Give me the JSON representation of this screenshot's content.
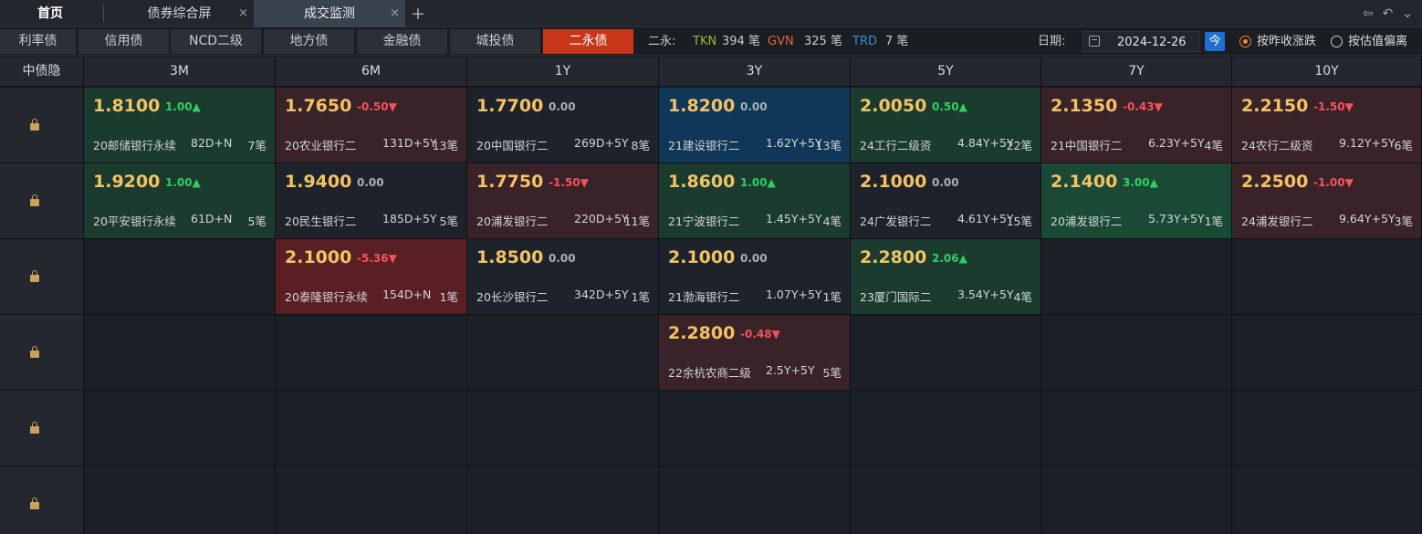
{
  "tabs": {
    "home": "首页",
    "bond_screen": "债券综合屏",
    "trade_monitor": "成交监测",
    "close": "×",
    "add": "+"
  },
  "window_controls": {
    "back_icon": "⇦",
    "undo_icon": "↶",
    "dropdown_icon": "⌄"
  },
  "categories": [
    "利率债",
    "信用债",
    "NCD二级",
    "地方债",
    "金融债",
    "城投债",
    "二永债"
  ],
  "active_category": "二永债",
  "summary": {
    "label": "二永:",
    "tkn_label": "TKN",
    "tkn_count": "394 笔",
    "gvn_label": "GVN",
    "gvn_count": "325 笔",
    "trd_label": "TRD",
    "trd_count": "7 笔"
  },
  "date": {
    "label": "日期:",
    "value": "2024-12-26",
    "today": "今"
  },
  "sort_options": {
    "by_change": "按昨收涨跌",
    "by_deviation": "按估值偏离",
    "selected": "按昨收涨跌"
  },
  "grid": {
    "corner": "中债隐",
    "columns": [
      "3M",
      "6M",
      "1Y",
      "3Y",
      "5Y",
      "7Y",
      "10Y"
    ],
    "rows": [
      [
        {
          "price": "1.8100",
          "chg": "1.00▲",
          "dir": "up",
          "name": "20邮储银行永续",
          "term": "82D+N",
          "count": "7笔"
        },
        {
          "price": "1.7650",
          "chg": "-0.50▼",
          "dir": "down",
          "name": "20农业银行二",
          "term": "131D+5Y",
          "count": "13笔"
        },
        {
          "price": "1.7700",
          "chg": "0.00",
          "dir": "flat",
          "name": "20中国银行二",
          "term": "269D+5Y",
          "count": "8笔"
        },
        {
          "price": "1.8200",
          "chg": "0.00",
          "dir": "blue",
          "name": "21建设银行二",
          "term": "1.62Y+5Y",
          "count": "13笔"
        },
        {
          "price": "2.0050",
          "chg": "0.50▲",
          "dir": "up",
          "name": "24工行二级资",
          "term": "4.84Y+5Y",
          "count": "22笔"
        },
        {
          "price": "2.1350",
          "chg": "-0.43▼",
          "dir": "down",
          "name": "21中国银行二",
          "term": "6.23Y+5Y",
          "count": "4笔"
        },
        {
          "price": "2.2150",
          "chg": "-1.50▼",
          "dir": "down",
          "name": "24农行二级资",
          "term": "9.12Y+5Y",
          "count": "6笔"
        }
      ],
      [
        {
          "price": "1.9200",
          "chg": "1.00▲",
          "dir": "up",
          "name": "20平安银行永续",
          "term": "61D+N",
          "count": "5笔"
        },
        {
          "price": "1.9400",
          "chg": "0.00",
          "dir": "flat",
          "name": "20民生银行二",
          "term": "185D+5Y",
          "count": "5笔"
        },
        {
          "price": "1.7750",
          "chg": "-1.50▼",
          "dir": "down",
          "name": "20浦发银行二",
          "term": "220D+5Y",
          "count": "11笔"
        },
        {
          "price": "1.8600",
          "chg": "1.00▲",
          "dir": "up",
          "name": "21宁波银行二",
          "term": "1.45Y+5Y",
          "count": "4笔"
        },
        {
          "price": "2.1000",
          "chg": "0.00",
          "dir": "flat",
          "name": "24广发银行二",
          "term": "4.61Y+5Y",
          "count": "15笔"
        },
        {
          "price": "2.1400",
          "chg": "3.00▲",
          "dir": "up2",
          "name": "20浦发银行二",
          "term": "5.73Y+5Y",
          "count": "1笔"
        },
        {
          "price": "2.2500",
          "chg": "-1.00▼",
          "dir": "down",
          "name": "24浦发银行二",
          "term": "9.64Y+5Y",
          "count": "3笔"
        }
      ],
      [
        null,
        {
          "price": "2.1000",
          "chg": "-5.36▼",
          "dir": "down2",
          "name": "20泰隆银行永续",
          "term": "154D+N",
          "count": "1笔"
        },
        {
          "price": "1.8500",
          "chg": "0.00",
          "dir": "flat",
          "name": "20长沙银行二",
          "term": "342D+5Y",
          "count": "1笔"
        },
        {
          "price": "2.1000",
          "chg": "0.00",
          "dir": "flat",
          "name": "21渤海银行二",
          "term": "1.07Y+5Y",
          "count": "1笔"
        },
        {
          "price": "2.2800",
          "chg": "2.06▲",
          "dir": "up",
          "name": "23厦门国际二",
          "term": "3.54Y+5Y",
          "count": "4笔"
        },
        null,
        null
      ],
      [
        null,
        null,
        null,
        {
          "price": "2.2800",
          "chg": "-0.48▼",
          "dir": "down",
          "name": "22余杭农商二级",
          "term": "2.5Y+5Y",
          "count": "5笔"
        },
        null,
        null,
        null
      ],
      [
        null,
        null,
        null,
        null,
        null,
        null,
        null
      ],
      [
        null,
        null,
        null,
        null,
        null,
        null,
        null
      ]
    ]
  }
}
